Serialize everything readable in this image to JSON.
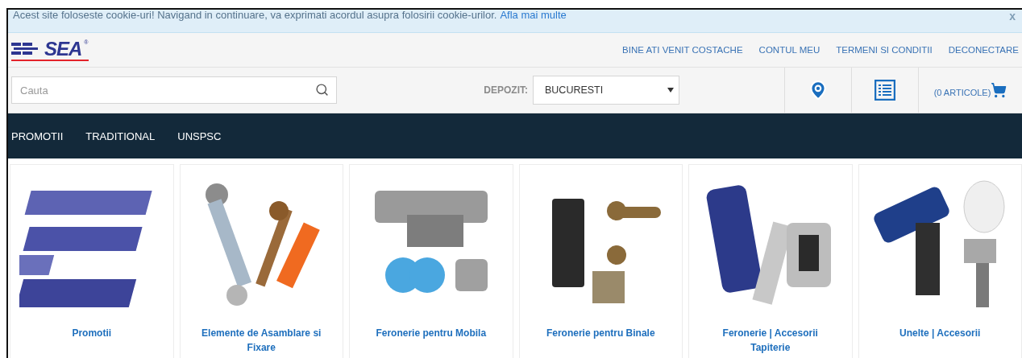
{
  "cookie_bar": {
    "text": "Acest site foloseste cookie-uri! Navigand in continuare, va exprimati acordul asupra folosirii cookie-urilor.",
    "link": "Afla mai multe",
    "close": "x"
  },
  "logo": {
    "text": "SEA",
    "mark": "®"
  },
  "top_links": [
    "BINE ATI VENIT COSTACHE",
    "CONTUL MEU",
    "TERMENI SI CONDITII",
    "DECONECTARE"
  ],
  "search": {
    "placeholder": "Cauta"
  },
  "depot": {
    "label": "DEPOZIT:",
    "value": "BUCURESTI"
  },
  "cart": {
    "text": "(0 ARTICOLE)"
  },
  "nav": [
    "PROMOTII",
    "TRADITIONAL",
    "UNSPSC"
  ],
  "categories": [
    {
      "title": "Promotii",
      "kind": "picture"
    },
    {
      "title": "Elemente de Asamblare si Fixare",
      "kind": "picture"
    },
    {
      "title": "Feronerie pentru Mobila",
      "kind": "picture"
    },
    {
      "title": "Feronerie pentru Binale",
      "kind": "picture"
    },
    {
      "title": "Feronerie | Accesorii Tapiterie",
      "kind": "picture"
    },
    {
      "title": "Unelte | Accesorii",
      "kind": "picture"
    }
  ]
}
